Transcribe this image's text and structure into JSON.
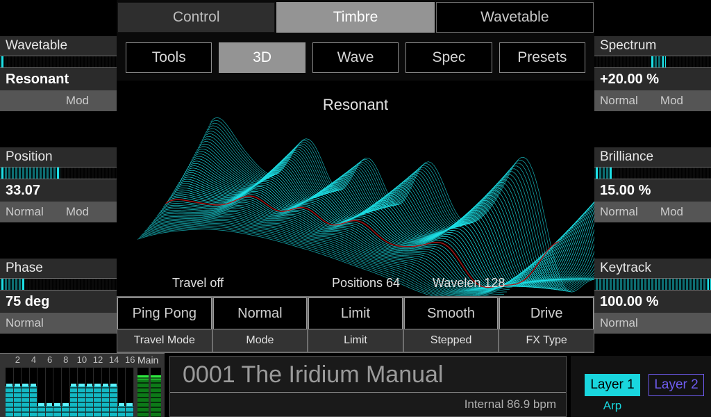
{
  "tabs": [
    {
      "label": "Control",
      "state": "dim"
    },
    {
      "label": "Timbre",
      "state": "active"
    },
    {
      "label": "Wavetable",
      "state": "normal"
    }
  ],
  "tools": [
    {
      "label": "Tools",
      "state": "normal"
    },
    {
      "label": "3D",
      "state": "active"
    },
    {
      "label": "Wave",
      "state": "normal"
    },
    {
      "label": "Spec",
      "state": "normal"
    },
    {
      "label": "Presets",
      "state": "normal"
    }
  ],
  "scope": {
    "title": "Resonant",
    "foot_left": "Travel off",
    "foot_mid": "Positions 64",
    "foot_right": "Wavelen 128",
    "wave_color": "#1ce0e6",
    "highlight_color": "#b01717"
  },
  "left_params": [
    {
      "name": "Wavetable",
      "value": "Resonant",
      "slider": {
        "fill_pct": 0,
        "knob_pct": 0.5
      },
      "mods": {
        "normal": "",
        "mod": "Mod"
      }
    },
    {
      "name": "Position",
      "value": "33.07",
      "slider": {
        "fill_pct": 52,
        "knob_pct": 52
      },
      "mods": {
        "normal": "Normal",
        "mod": "Mod"
      }
    },
    {
      "name": "Phase",
      "value": "75 deg",
      "slider": {
        "fill_pct": 21,
        "knob_pct": 21
      },
      "mods": {
        "normal": "Normal",
        "mod": ""
      }
    }
  ],
  "right_params": [
    {
      "name": "Spectrum",
      "value": "+20.00 %",
      "slider": {
        "fill_pct": 0,
        "knob_pct": 50,
        "bipolar": true,
        "bi_end_pct": 60
      },
      "mods": {
        "normal": "Normal",
        "mod": "Mod"
      }
    },
    {
      "name": "Brilliance",
      "value": "15.00 %",
      "slider": {
        "fill_pct": 15,
        "knob_pct": 15
      },
      "mods": {
        "normal": "Normal",
        "mod": "Mod"
      }
    },
    {
      "name": "Keytrack",
      "value": "100.00 %",
      "slider": {
        "fill_pct": 100,
        "knob_pct": 99
      },
      "mods": {
        "normal": "Normal",
        "mod": ""
      }
    }
  ],
  "matrix": [
    {
      "value": "Ping Pong",
      "label": "Travel Mode"
    },
    {
      "value": "Normal",
      "label": "Mode"
    },
    {
      "value": "Limit",
      "label": "Limit"
    },
    {
      "value": "Smooth",
      "label": "Stepped"
    },
    {
      "value": "Drive",
      "label": "FX Type"
    }
  ],
  "mixer": {
    "ruler_labels": [
      "2",
      "4",
      "6",
      "8",
      "10",
      "12",
      "14",
      "16"
    ],
    "main_label": "Main",
    "channel_levels": [
      62,
      62,
      62,
      62,
      22,
      22,
      22,
      22,
      62,
      62,
      62,
      62,
      62,
      62,
      22,
      22
    ],
    "main_levels": [
      76,
      76
    ],
    "channel_color": "#13b9c4",
    "main_color": "#0d7a18"
  },
  "preset": {
    "name": "0001 The Iridium Manual",
    "tempo": "Internal 86.9 bpm"
  },
  "layers": {
    "layer1": "Layer 1",
    "layer2": "Layer 2",
    "arp": "Arp",
    "layer1_color": "#19d6de",
    "layer2_color": "#6f5cf0"
  }
}
